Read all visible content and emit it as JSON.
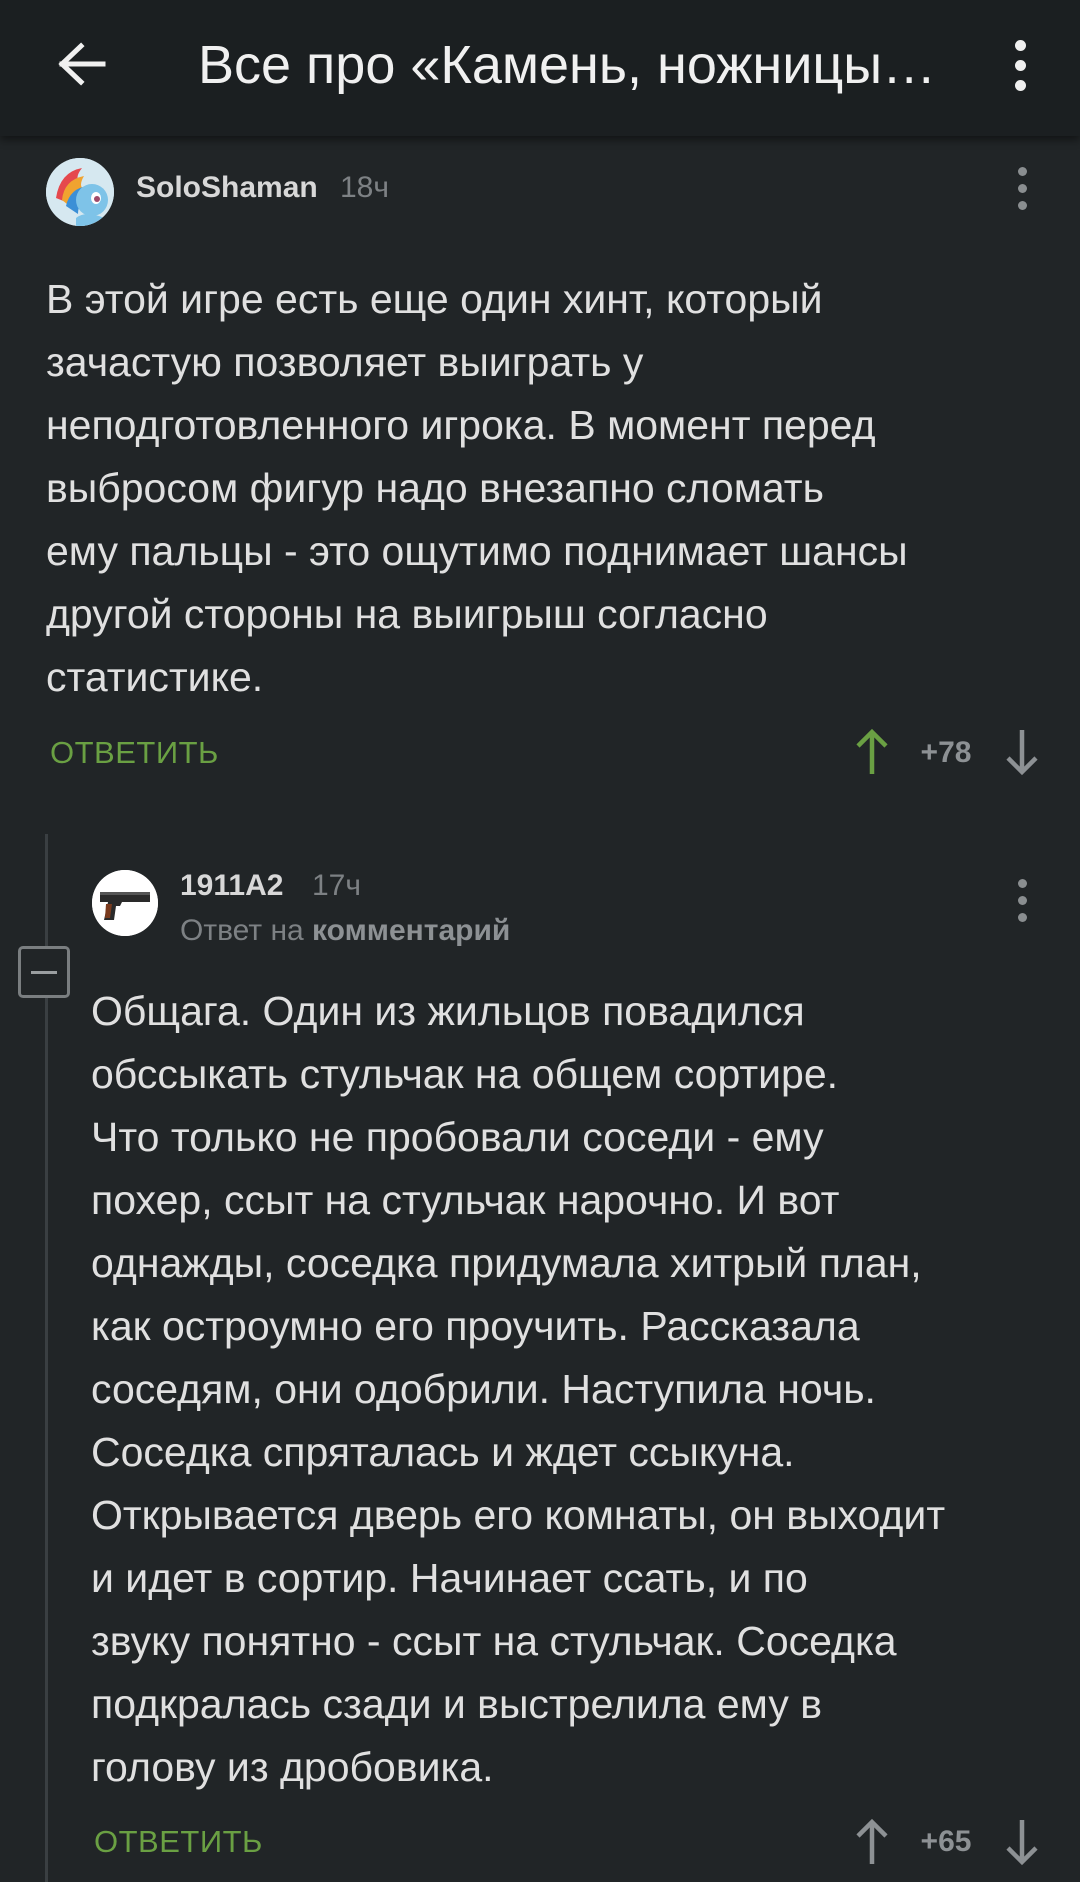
{
  "appbar": {
    "title": "Все про «Камень, ножницы…",
    "back_icon": "arrow-left-icon",
    "menu_icon": "more-vert-icon"
  },
  "comments": [
    {
      "username": "SoloShaman",
      "time": "18ч",
      "text_lines": [
        "В этой игре есть еще один хинт, который",
        "зачастую позволяет выиграть у",
        "неподготовленного игрока. В момент перед",
        "выбросом фигур надо внезапно сломать",
        "ему пальцы - это ощутимо поднимает шансы",
        "другой стороны на выигрыш согласно",
        "статистике."
      ],
      "reply_label": "ОТВЕТИТЬ",
      "score": "+78",
      "upvoted": true
    },
    {
      "username": "1911A2",
      "time": "17ч",
      "reply_to_prefix": "Ответ на",
      "reply_to_target": "комментарий",
      "text_lines": [
        "Общага. Один из жильцов повадился",
        "обссыкать стульчак на общем сортире.",
        "Что только не пробовали соседи - ему",
        "похер, ссыт на стульчак нарочно. И вот",
        "однажды, соседка придумала хитрый план,",
        "как остроумно его проучить. Рассказала",
        "соседям, они одобрили. Наступила ночь.",
        "Соседка спряталась и ждет ссыкуна.",
        "Открывается дверь его комнаты, он выходит",
        "и идет в сортир. Начинает ссать, и по",
        "звуку понятно - ссыт на стульчак. Соседка",
        "подкралась сзади и выстрелила ему в",
        "голову из дробовика."
      ],
      "reply_label": "ОТВЕТИТЬ",
      "score": "+65",
      "upvoted": false
    }
  ],
  "colors": {
    "background": "#212527",
    "appbar": "#1b1f21",
    "accent_green": "#6aa043",
    "muted": "#7d8184"
  }
}
